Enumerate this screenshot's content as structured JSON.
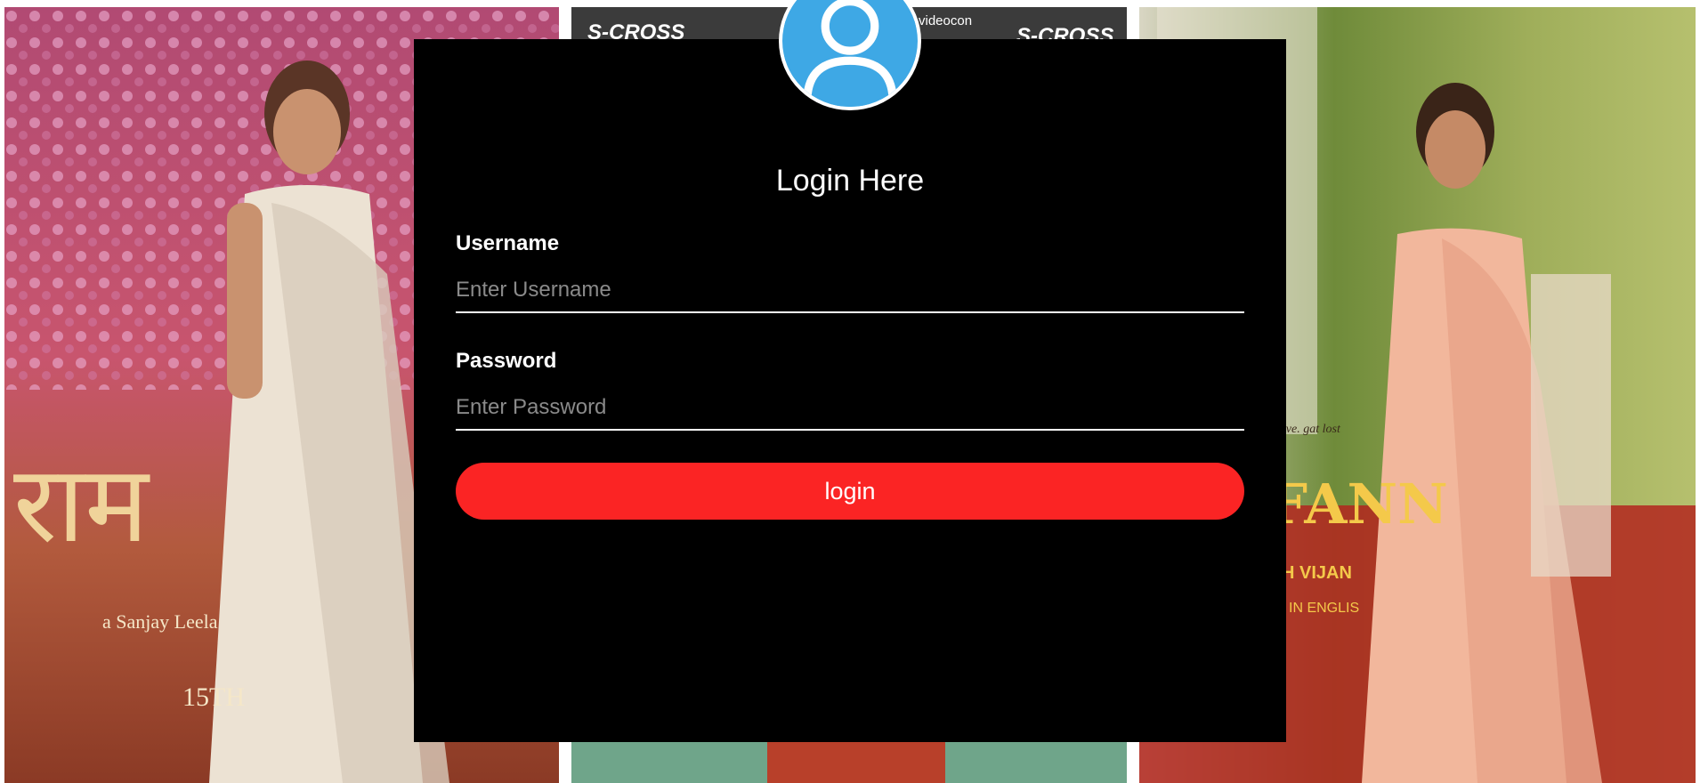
{
  "login": {
    "title": "Login Here",
    "username_label": "Username",
    "username_placeholder": "Enter Username",
    "password_label": "Password",
    "password_placeholder": "Enter Password",
    "button_label": "login"
  },
  "background": {
    "left_poster_text": "राम",
    "left_poster_credit": "a Sanjay Leela",
    "left_poster_date": "15TH",
    "middle_sponsor_1": "S-CROSS",
    "middle_sponsor_2": "videocon",
    "middle_sponsor_3": "S-CROSS",
    "right_poster_text": "FANN",
    "right_poster_caption": "Love. gat lost",
    "right_poster_subtext": "H VIJAN",
    "right_poster_lang": "IN ENGLIS"
  },
  "colors": {
    "card": "#000000",
    "button": "#fb2424",
    "avatar": "#3ea8e5"
  },
  "icons": {
    "avatar": "user-icon"
  }
}
